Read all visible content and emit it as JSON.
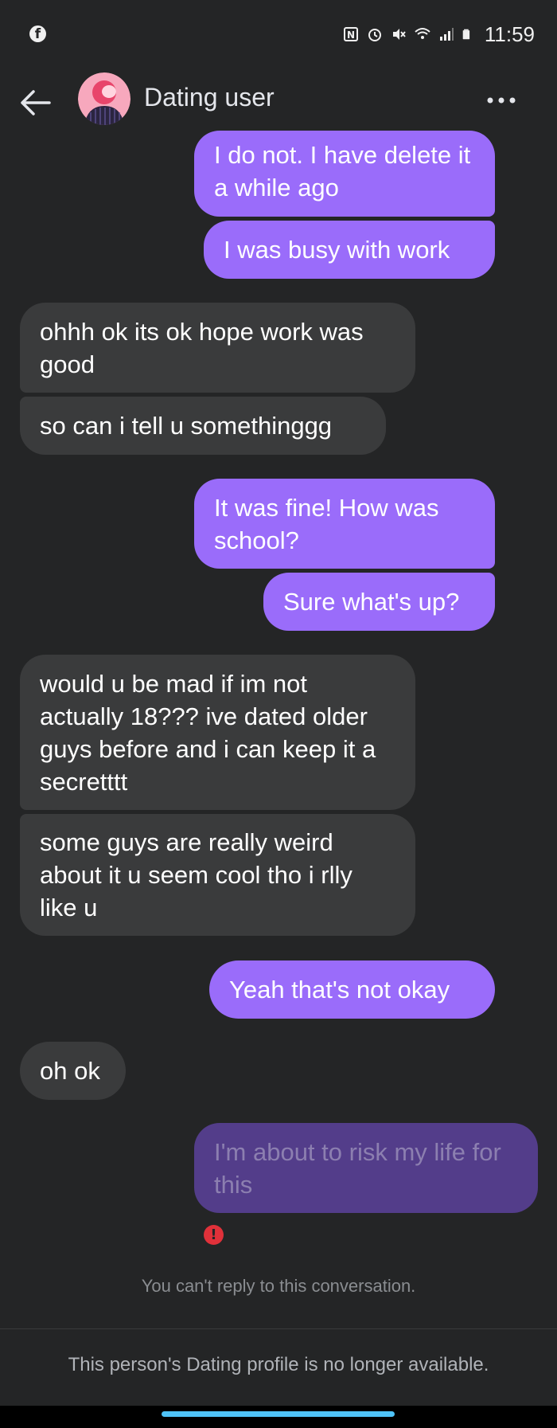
{
  "status_bar": {
    "time": "11:59",
    "icons": [
      "facebook-icon",
      "nfc-icon",
      "alarm-icon",
      "mute-icon",
      "wifi-icon",
      "signal-icon",
      "battery-icon"
    ]
  },
  "header": {
    "contact_name": "Dating user",
    "icons": [
      "back-arrow-icon",
      "avatar",
      "more-icon"
    ]
  },
  "messages": [
    {
      "direction": "sent",
      "text": "I do not. I have delete it a while ago"
    },
    {
      "direction": "sent",
      "text": "I was busy with work"
    },
    {
      "direction": "received",
      "text": "ohhh ok its ok hope work was good"
    },
    {
      "direction": "received",
      "text": "so can i tell u somethinggg"
    },
    {
      "direction": "sent",
      "text": "It was fine! How was school?"
    },
    {
      "direction": "sent",
      "text": "Sure what's up?"
    },
    {
      "direction": "received",
      "text": "would u be mad if im not actually 18??? ive dated older guys before and i can keep it a secretttt"
    },
    {
      "direction": "received",
      "text": "some guys are really weird about it u seem cool tho i rlly like u"
    },
    {
      "direction": "sent",
      "text": "Yeah that's not okay"
    },
    {
      "direction": "received",
      "text": "oh ok"
    },
    {
      "direction": "failed",
      "text": "I'm about to risk my life for this"
    }
  ],
  "error_indicator": "!",
  "cant_reply_text": "You can't reply to this conversation.",
  "footer_text": "This person's Dating profile is no longer available.",
  "colors": {
    "background": "#242526",
    "sent_bubble": "#9a6cfa",
    "received_bubble": "#3a3b3c",
    "failed_bubble": "#533d8a",
    "error": "#e0313a",
    "home_indicator": "#4fc3f7"
  }
}
